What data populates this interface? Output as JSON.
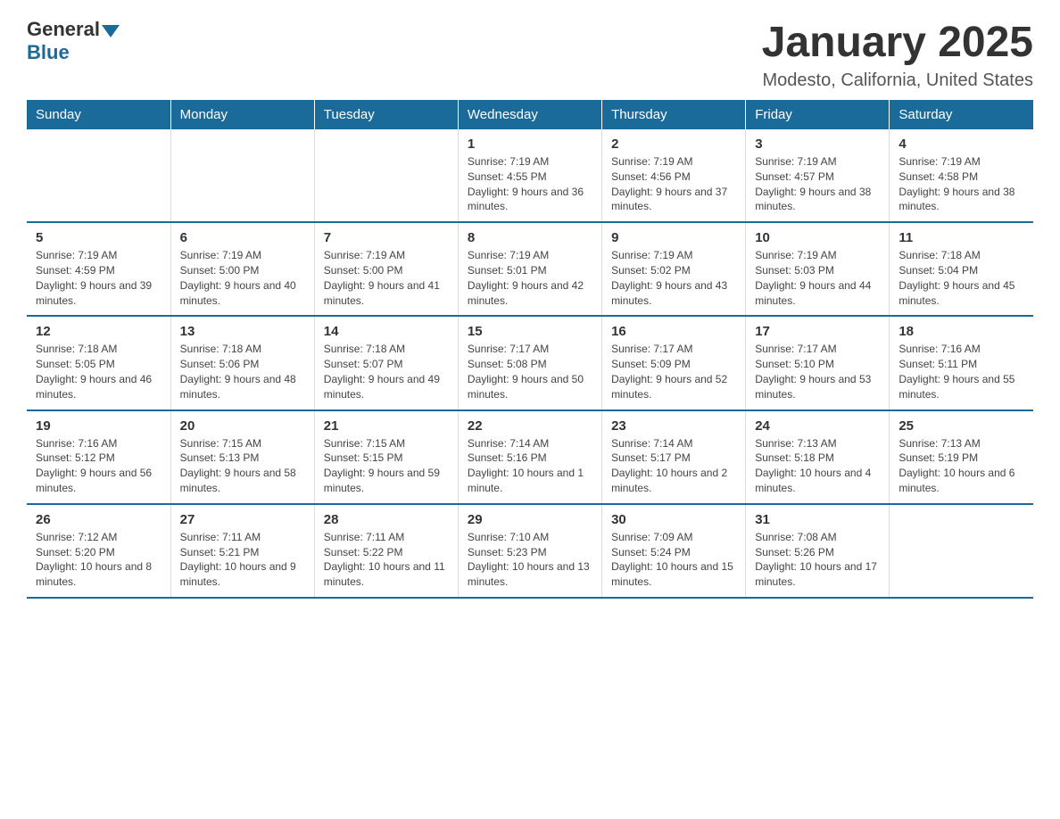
{
  "logo": {
    "general": "General",
    "blue": "Blue"
  },
  "title": "January 2025",
  "location": "Modesto, California, United States",
  "headers": [
    "Sunday",
    "Monday",
    "Tuesday",
    "Wednesday",
    "Thursday",
    "Friday",
    "Saturday"
  ],
  "weeks": [
    [
      {
        "day": "",
        "info": ""
      },
      {
        "day": "",
        "info": ""
      },
      {
        "day": "",
        "info": ""
      },
      {
        "day": "1",
        "info": "Sunrise: 7:19 AM\nSunset: 4:55 PM\nDaylight: 9 hours and 36 minutes."
      },
      {
        "day": "2",
        "info": "Sunrise: 7:19 AM\nSunset: 4:56 PM\nDaylight: 9 hours and 37 minutes."
      },
      {
        "day": "3",
        "info": "Sunrise: 7:19 AM\nSunset: 4:57 PM\nDaylight: 9 hours and 38 minutes."
      },
      {
        "day": "4",
        "info": "Sunrise: 7:19 AM\nSunset: 4:58 PM\nDaylight: 9 hours and 38 minutes."
      }
    ],
    [
      {
        "day": "5",
        "info": "Sunrise: 7:19 AM\nSunset: 4:59 PM\nDaylight: 9 hours and 39 minutes."
      },
      {
        "day": "6",
        "info": "Sunrise: 7:19 AM\nSunset: 5:00 PM\nDaylight: 9 hours and 40 minutes."
      },
      {
        "day": "7",
        "info": "Sunrise: 7:19 AM\nSunset: 5:00 PM\nDaylight: 9 hours and 41 minutes."
      },
      {
        "day": "8",
        "info": "Sunrise: 7:19 AM\nSunset: 5:01 PM\nDaylight: 9 hours and 42 minutes."
      },
      {
        "day": "9",
        "info": "Sunrise: 7:19 AM\nSunset: 5:02 PM\nDaylight: 9 hours and 43 minutes."
      },
      {
        "day": "10",
        "info": "Sunrise: 7:19 AM\nSunset: 5:03 PM\nDaylight: 9 hours and 44 minutes."
      },
      {
        "day": "11",
        "info": "Sunrise: 7:18 AM\nSunset: 5:04 PM\nDaylight: 9 hours and 45 minutes."
      }
    ],
    [
      {
        "day": "12",
        "info": "Sunrise: 7:18 AM\nSunset: 5:05 PM\nDaylight: 9 hours and 46 minutes."
      },
      {
        "day": "13",
        "info": "Sunrise: 7:18 AM\nSunset: 5:06 PM\nDaylight: 9 hours and 48 minutes."
      },
      {
        "day": "14",
        "info": "Sunrise: 7:18 AM\nSunset: 5:07 PM\nDaylight: 9 hours and 49 minutes."
      },
      {
        "day": "15",
        "info": "Sunrise: 7:17 AM\nSunset: 5:08 PM\nDaylight: 9 hours and 50 minutes."
      },
      {
        "day": "16",
        "info": "Sunrise: 7:17 AM\nSunset: 5:09 PM\nDaylight: 9 hours and 52 minutes."
      },
      {
        "day": "17",
        "info": "Sunrise: 7:17 AM\nSunset: 5:10 PM\nDaylight: 9 hours and 53 minutes."
      },
      {
        "day": "18",
        "info": "Sunrise: 7:16 AM\nSunset: 5:11 PM\nDaylight: 9 hours and 55 minutes."
      }
    ],
    [
      {
        "day": "19",
        "info": "Sunrise: 7:16 AM\nSunset: 5:12 PM\nDaylight: 9 hours and 56 minutes."
      },
      {
        "day": "20",
        "info": "Sunrise: 7:15 AM\nSunset: 5:13 PM\nDaylight: 9 hours and 58 minutes."
      },
      {
        "day": "21",
        "info": "Sunrise: 7:15 AM\nSunset: 5:15 PM\nDaylight: 9 hours and 59 minutes."
      },
      {
        "day": "22",
        "info": "Sunrise: 7:14 AM\nSunset: 5:16 PM\nDaylight: 10 hours and 1 minute."
      },
      {
        "day": "23",
        "info": "Sunrise: 7:14 AM\nSunset: 5:17 PM\nDaylight: 10 hours and 2 minutes."
      },
      {
        "day": "24",
        "info": "Sunrise: 7:13 AM\nSunset: 5:18 PM\nDaylight: 10 hours and 4 minutes."
      },
      {
        "day": "25",
        "info": "Sunrise: 7:13 AM\nSunset: 5:19 PM\nDaylight: 10 hours and 6 minutes."
      }
    ],
    [
      {
        "day": "26",
        "info": "Sunrise: 7:12 AM\nSunset: 5:20 PM\nDaylight: 10 hours and 8 minutes."
      },
      {
        "day": "27",
        "info": "Sunrise: 7:11 AM\nSunset: 5:21 PM\nDaylight: 10 hours and 9 minutes."
      },
      {
        "day": "28",
        "info": "Sunrise: 7:11 AM\nSunset: 5:22 PM\nDaylight: 10 hours and 11 minutes."
      },
      {
        "day": "29",
        "info": "Sunrise: 7:10 AM\nSunset: 5:23 PM\nDaylight: 10 hours and 13 minutes."
      },
      {
        "day": "30",
        "info": "Sunrise: 7:09 AM\nSunset: 5:24 PM\nDaylight: 10 hours and 15 minutes."
      },
      {
        "day": "31",
        "info": "Sunrise: 7:08 AM\nSunset: 5:26 PM\nDaylight: 10 hours and 17 minutes."
      },
      {
        "day": "",
        "info": ""
      }
    ]
  ]
}
